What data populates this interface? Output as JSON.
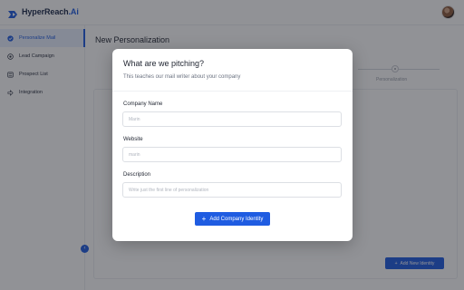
{
  "app": {
    "brand_prefix": "HyperReach",
    "brand_suffix": ".Ai",
    "accent_color": "#1f5ce1"
  },
  "sidebar": {
    "items": [
      {
        "label": "Personalize Mail",
        "icon": "check-badge-icon",
        "active": true
      },
      {
        "label": "Lead Campaign",
        "icon": "target-icon",
        "active": false
      },
      {
        "label": "Prospect List",
        "icon": "list-icon",
        "active": false
      },
      {
        "label": "Integration",
        "icon": "plug-icon",
        "active": false
      }
    ],
    "collapse_icon": "chevron-left-icon",
    "collapse_glyph": "‹"
  },
  "main": {
    "title": "New Personalization",
    "stepper_label": "Personalization",
    "add_identity_label": "Add New Identity"
  },
  "modal": {
    "title": "What are we pitching?",
    "subtitle": "This teaches our mail writer about your company",
    "fields": [
      {
        "label": "Company Name",
        "placeholder": "Marin",
        "value": ""
      },
      {
        "label": "Website",
        "placeholder": "marin",
        "value": ""
      },
      {
        "label": "Description",
        "placeholder": "Write just the first line of personalization",
        "value": ""
      }
    ],
    "submit_label": "Add Company Identity",
    "submit_icon": "plus-icon",
    "plus_glyph": "+"
  }
}
